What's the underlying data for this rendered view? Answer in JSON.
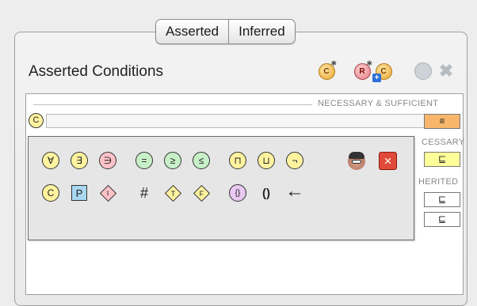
{
  "tabs": [
    "Asserted",
    "Inferred"
  ],
  "title": "Asserted Conditions",
  "toolbar": {
    "create_restriction": "C",
    "add_restriction": "R",
    "add_named_class": "C"
  },
  "sections": {
    "necessary_sufficient": "NECESSARY & SUFFICIENT",
    "necessary": "CESSARY",
    "inherited": "HERITED"
  },
  "condition_row": {
    "icon": "C",
    "value": "",
    "operator": "≡",
    "operator_color": "#f7b66b"
  },
  "necessary_op": {
    "symbol": "⊑",
    "color": "#ffff9a"
  },
  "inherited_ops": [
    "⊑",
    "⊑"
  ],
  "palette": {
    "row1": [
      {
        "sym": "∀",
        "color": "#fff3a0"
      },
      {
        "sym": "∃",
        "color": "#fff3a0"
      },
      {
        "sym": "∋",
        "color": "#ffc2c8"
      },
      {
        "sym": "=",
        "color": "#c8f0c8"
      },
      {
        "sym": "≥",
        "color": "#c8f0c8"
      },
      {
        "sym": "≤",
        "color": "#c8f0c8"
      },
      {
        "sym": "⊓",
        "color": "#fff3a0"
      },
      {
        "sym": "⊔",
        "color": "#fff3a0"
      },
      {
        "sym": "¬",
        "color": "#fff3a0"
      }
    ],
    "row2": [
      {
        "sym": "C",
        "shape": "circle",
        "color": "#fff3a0"
      },
      {
        "sym": "P",
        "shape": "square",
        "color": "#a8d8f0"
      },
      {
        "sym": "I",
        "shape": "diamond",
        "color": "#ffc2c8"
      },
      {
        "sym": "#",
        "shape": "plain",
        "color": "#e6e6e6"
      },
      {
        "sym": "T",
        "shape": "diamond",
        "color": "#fff3a0"
      },
      {
        "sym": "F",
        "shape": "diamond",
        "color": "#fff3a0"
      },
      {
        "sym": "{}",
        "shape": "circle",
        "color": "#e8c8f0"
      },
      {
        "sym": "()",
        "shape": "plain",
        "color": "#e6e6e6"
      },
      {
        "sym": "←",
        "shape": "arrow",
        "color": "#e6e6e6"
      }
    ],
    "close": "×"
  }
}
